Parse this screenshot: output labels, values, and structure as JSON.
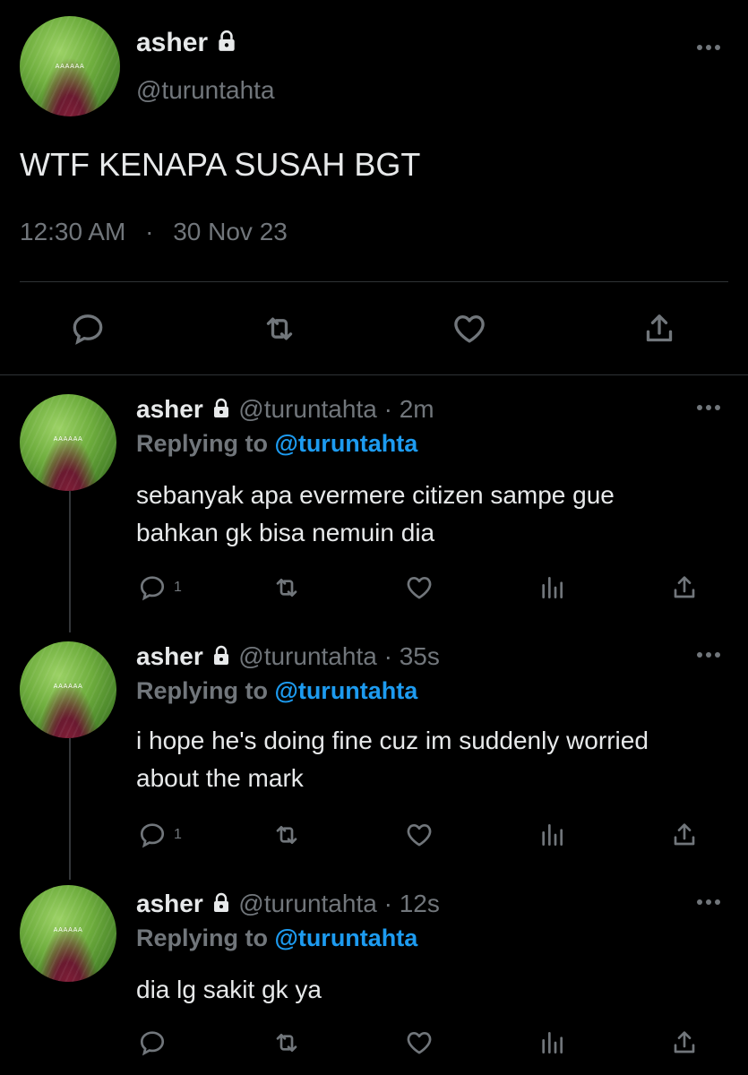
{
  "main_tweet": {
    "display_name": "asher",
    "handle": "@turuntahta",
    "avatar_caption": "AAAAAA",
    "text": "WTF KENAPA SUSAH BGT",
    "time": "12:30 AM",
    "separator": "·",
    "date": "30 Nov 23",
    "icons": {
      "more": "more-horizontal-icon",
      "reply": "reply-icon",
      "retweet": "retweet-icon",
      "like": "heart-icon",
      "share": "share-icon"
    }
  },
  "replies": [
    {
      "display_name": "asher",
      "handle": "@turuntahta",
      "age": "· 2m",
      "replying_prefix": "Replying to ",
      "replying_to": "@turuntahta",
      "avatar_caption": "AAAAAA",
      "text_line1": "sebanyak apa evermere citizen sampe gue",
      "text_line2": "bahkan gk bisa nemuin dia",
      "reply_count": "1"
    },
    {
      "display_name": "asher",
      "handle": "@turuntahta",
      "age": "· 35s",
      "replying_prefix": "Replying to ",
      "replying_to": "@turuntahta",
      "avatar_caption": "AAAAAA",
      "text_line1": "i hope he's doing fine cuz im suddenly worried",
      "text_line2": "about the mark",
      "reply_count": "1"
    },
    {
      "display_name": "asher",
      "handle": "@turuntahta",
      "age": "· 12s",
      "replying_prefix": "Replying to ",
      "replying_to": "@turuntahta",
      "avatar_caption": "AAAAAA",
      "text_line1": "dia lg sakit gk ya",
      "text_line2": "",
      "reply_count": ""
    }
  ],
  "colors": {
    "background": "#000000",
    "text": "#e7e9ea",
    "muted": "#71767b",
    "link": "#1d9bf0",
    "divider": "#2f3336"
  }
}
